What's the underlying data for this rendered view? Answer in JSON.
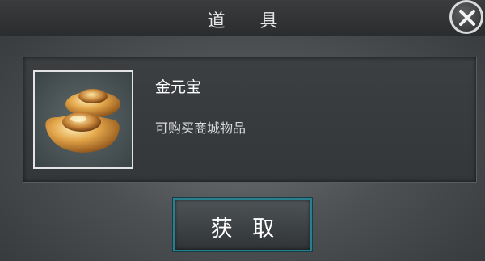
{
  "dialog": {
    "title": "道 具",
    "close_icon": "close-x-icon"
  },
  "item": {
    "name": "金元宝",
    "description": "可购买商城物品",
    "icon": "gold-ingot-icon"
  },
  "actions": {
    "obtain_label": "获 取"
  },
  "colors": {
    "accent_border": "#2a7f8e",
    "title_text": "#e6e6e6",
    "gold": "#d9a441"
  }
}
